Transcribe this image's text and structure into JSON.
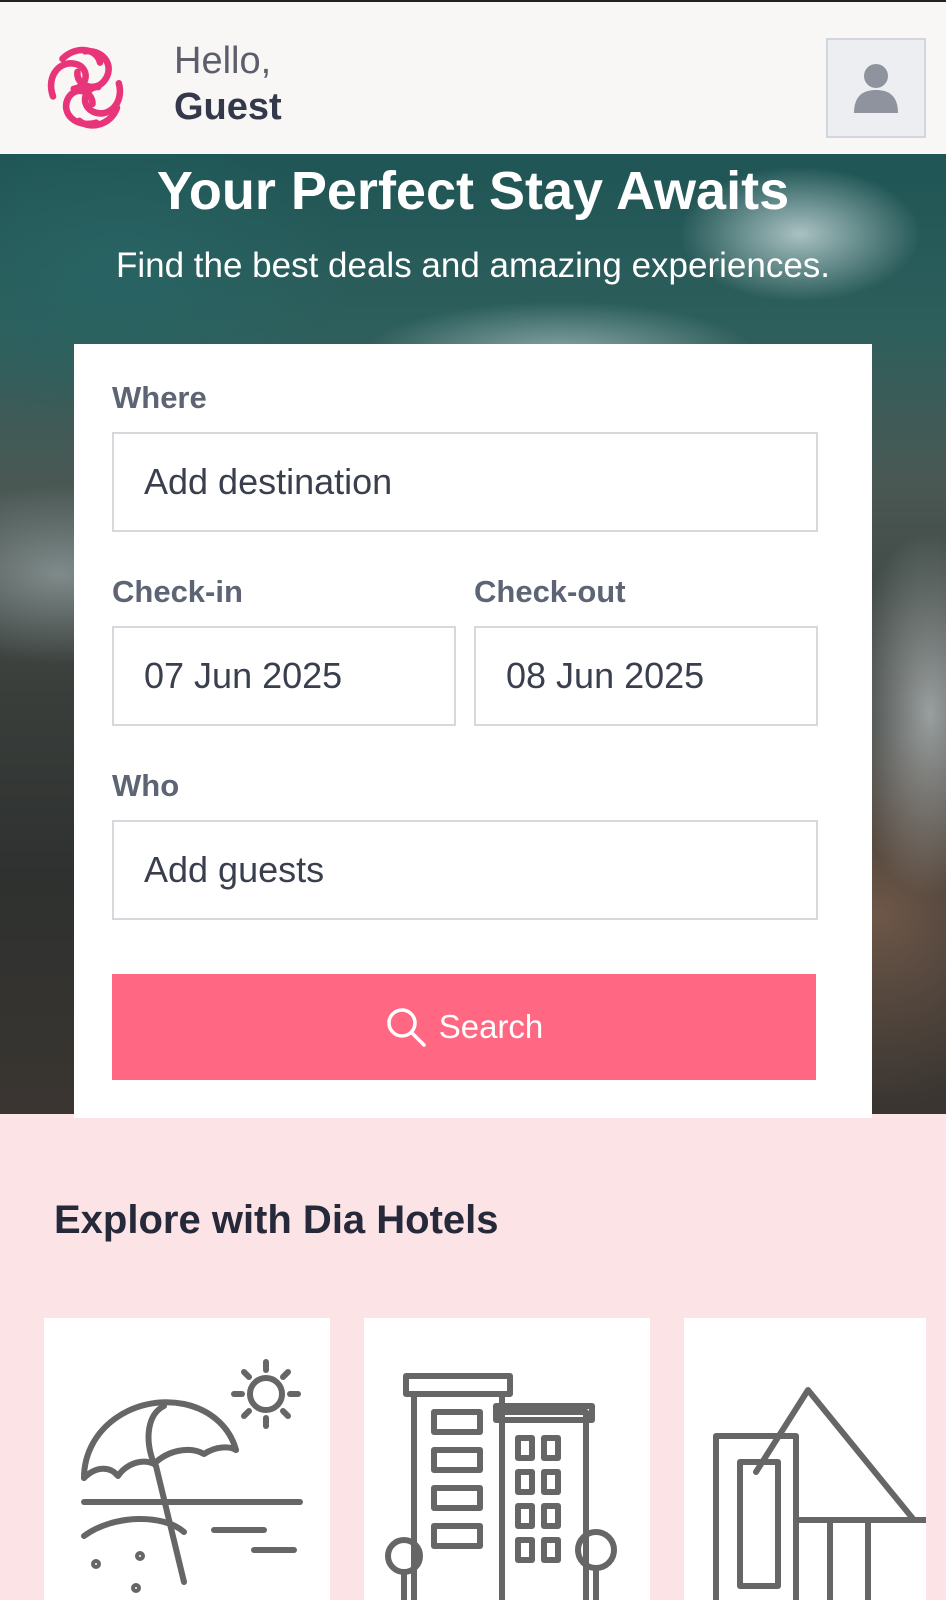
{
  "header": {
    "greeting": "Hello,",
    "username": "Guest",
    "logo_icon": "pink-knot-logo",
    "avatar_icon": "user-icon"
  },
  "hero": {
    "title": "Your Perfect Stay Awaits",
    "subtitle": "Find the best deals and amazing experiences."
  },
  "search_form": {
    "where_label": "Where",
    "where_placeholder": "Add destination",
    "checkin_label": "Check-in",
    "checkin_value": "07 Jun 2025",
    "checkout_label": "Check-out",
    "checkout_value": "08 Jun 2025",
    "who_label": "Who",
    "who_placeholder": "Add guests",
    "search_label": "Search",
    "search_icon": "search-icon"
  },
  "explore": {
    "title": "Explore with Dia Hotels",
    "tiles": [
      {
        "icon": "beach-umbrella-icon"
      },
      {
        "icon": "city-buildings-icon"
      },
      {
        "icon": "cabin-house-icon"
      }
    ]
  },
  "colors": {
    "brand": "#e8357a",
    "button": "#ff6782",
    "page_bg": "#fbe3e6"
  }
}
